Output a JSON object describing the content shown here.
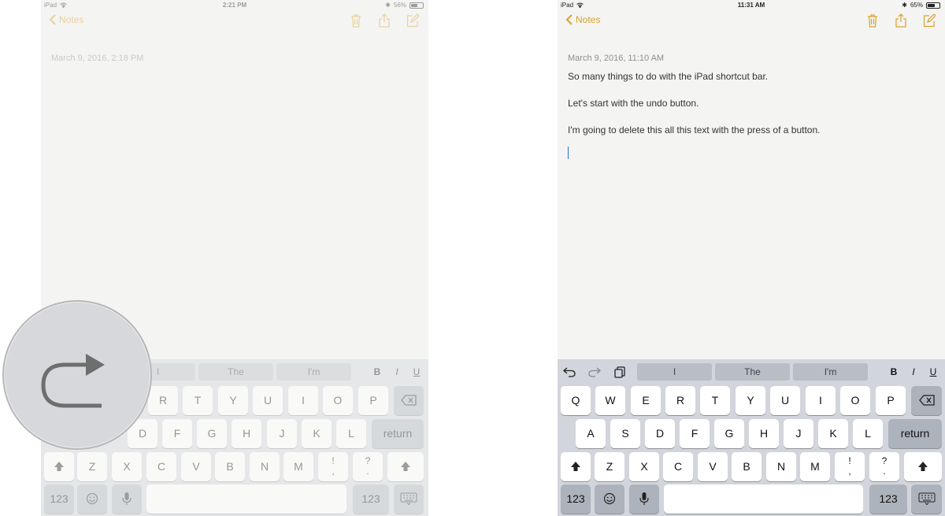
{
  "left": {
    "status": {
      "device": "iPad",
      "time": "2:21 PM",
      "battery": "56%",
      "battery_level": 0.56
    },
    "nav": {
      "back_label": "Notes"
    },
    "note": {
      "date": "March 9, 2016, 2:18 PM"
    },
    "suggestions": [
      "I",
      "The",
      "I'm"
    ],
    "format": {
      "bold": "B",
      "italic": "I",
      "underline": "U"
    },
    "keys": {
      "row1": [
        "R",
        "T",
        "Y",
        "U",
        "I",
        "O",
        "P"
      ],
      "row2": [
        "D",
        "F",
        "G",
        "H",
        "J",
        "K",
        "L"
      ],
      "return": "return",
      "row3": [
        "Z",
        "X",
        "C",
        "V",
        "B",
        "N",
        "M"
      ],
      "punct1": {
        "top": "!",
        "bottom": ","
      },
      "punct2": {
        "top": "?",
        "bottom": "."
      },
      "numbers": "123"
    }
  },
  "right": {
    "status": {
      "device": "iPad",
      "time": "11:31 AM",
      "battery": "65%",
      "battery_level": 0.65
    },
    "nav": {
      "back_label": "Notes"
    },
    "note": {
      "date": "March 9, 2016, 11:10 AM",
      "lines": [
        "So many things to do with the iPad shortcut bar.",
        "Let's start with the undo button.",
        "I'm going to delete this all this text with the press of a button."
      ]
    },
    "suggestions": [
      "I",
      "The",
      "I'm"
    ],
    "format": {
      "bold": "B",
      "italic": "I",
      "underline": "U"
    },
    "keys": {
      "row1": [
        "Q",
        "W",
        "E",
        "R",
        "T",
        "Y",
        "U",
        "I",
        "O",
        "P"
      ],
      "row2": [
        "A",
        "S",
        "D",
        "F",
        "G",
        "H",
        "J",
        "K",
        "L"
      ],
      "return": "return",
      "row3": [
        "Z",
        "X",
        "C",
        "V",
        "B",
        "N",
        "M"
      ],
      "punct1": {
        "top": "!",
        "bottom": ","
      },
      "punct2": {
        "top": "?",
        "bottom": "."
      },
      "numbers": "123"
    }
  },
  "colors": {
    "accent": "#d9a22a",
    "keyboard_bg": "#d2d5db",
    "key_bg": "#ffffff",
    "key_gray": "#adb3bc",
    "cursor": "#2f6fe0"
  },
  "icons": {
    "nav": [
      "trash-icon",
      "share-icon",
      "compose-icon"
    ],
    "shortcut": [
      "undo-icon",
      "redo-icon",
      "paste-icon"
    ],
    "zoom": "redo-arrow-icon"
  }
}
